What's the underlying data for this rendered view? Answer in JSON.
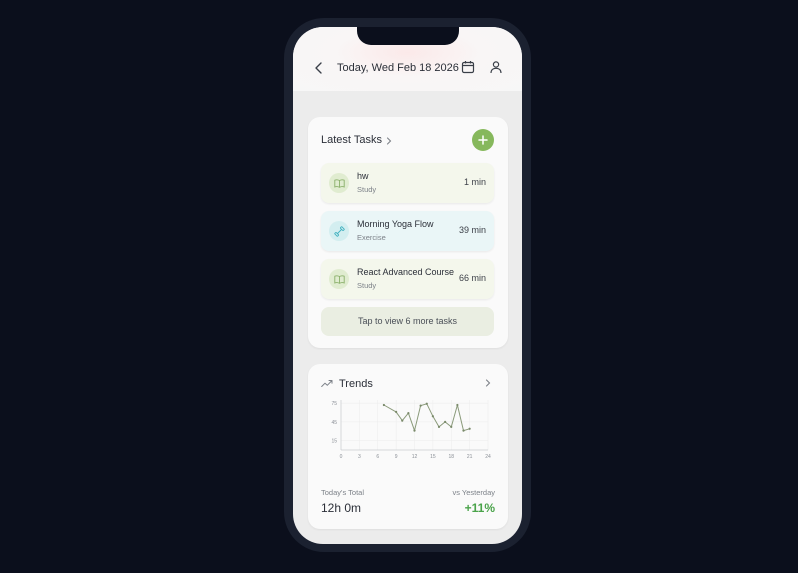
{
  "header": {
    "date": "Today, Wed Feb 18 2026"
  },
  "tasks": {
    "title": "Latest Tasks",
    "items": [
      {
        "name": "hw",
        "category": "Study",
        "duration": "1 min",
        "icon": "book-icon"
      },
      {
        "name": "Morning Yoga Flow",
        "category": "Exercise",
        "duration": "39 min",
        "icon": "dumbbell-icon"
      },
      {
        "name": "React Advanced Course",
        "category": "Study",
        "duration": "66 min",
        "icon": "book-icon"
      }
    ],
    "more_label": "Tap to view 6 more tasks"
  },
  "trends": {
    "title": "Trends",
    "total_label": "Today's Total",
    "total_value": "12h 0m",
    "vs_label": "vs Yesterday",
    "vs_value": "+11%"
  },
  "colors": {
    "accent": "#86b85c",
    "line": "#8a9a7a",
    "positive": "#4aa34a"
  },
  "chart_data": {
    "type": "line",
    "x": [
      7,
      9,
      10,
      11,
      12,
      13,
      14,
      15,
      16,
      17,
      18,
      19,
      20,
      21,
      22,
      23
    ],
    "y": [
      72,
      61,
      47,
      59,
      31,
      71,
      74,
      54,
      37,
      45,
      37,
      72,
      31,
      34
    ],
    "xticks": [
      "0",
      "3",
      "6",
      "9",
      "12",
      "15",
      "18",
      "21",
      "24"
    ],
    "yticks": [
      "75",
      "45",
      "15"
    ],
    "xlim": [
      0,
      24
    ],
    "ylim": [
      0,
      80
    ],
    "grid": true
  }
}
